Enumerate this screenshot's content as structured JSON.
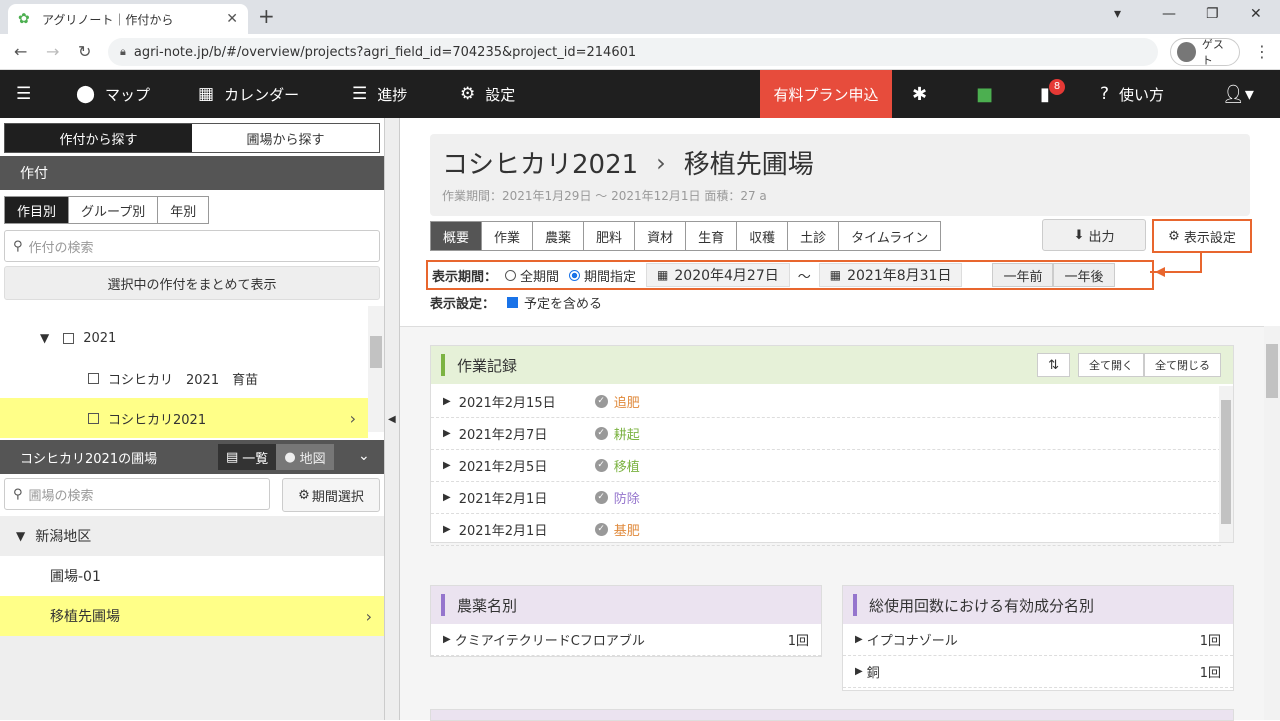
{
  "browser": {
    "tab_title": "アグリノート｜作付から",
    "url": "agri-note.jp/b/#/overview/projects?agri_field_id=704235&project_id=214601",
    "guest_label": "ゲスト"
  },
  "nav": {
    "items": [
      "マップ",
      "カレンダー",
      "進捗",
      "設定"
    ],
    "paid_plan": "有料プラン申込",
    "help": "使い方",
    "notification_count": "8"
  },
  "left": {
    "search_tabs": [
      "作付から探す",
      "圃場から探す"
    ],
    "crop_section": "作付",
    "crop_groups": [
      "作目別",
      "グループ別",
      "年別"
    ],
    "crop_search_placeholder": "作付の検索",
    "show_selected": "選択中の作付をまとめて表示",
    "tree": [
      {
        "label": "2021"
      },
      {
        "label": "コシヒカリ　2021　育苗"
      },
      {
        "label": "コシヒカリ2021"
      }
    ],
    "field_section": "コシヒカリ2021の圃場",
    "view_list": "一覧",
    "view_map": "地図",
    "field_search_placeholder": "圃場の検索",
    "period_select": "期間選択",
    "regions": [
      {
        "label": "新潟地区"
      },
      {
        "label": "圃場-01"
      },
      {
        "label": "移植先圃場"
      }
    ]
  },
  "main": {
    "crumb1": "コシヒカリ2021",
    "crumb2": "移植先圃場",
    "meta": "作業期間：2021年1月29日 ～ 2021年12月1日 面積：27 a",
    "subtabs": [
      "概要",
      "作業",
      "農薬",
      "肥料",
      "資材",
      "生育",
      "収穫",
      "土診",
      "タイムライン"
    ],
    "export": "出力",
    "display_settings": "表示設定",
    "period_label": "表示期間：",
    "all_period": "全期間",
    "specify_period": "期間指定",
    "date_from": "2020年4月27日",
    "tilde": "～",
    "date_to": "2021年8月31日",
    "prev_year": "一年前",
    "next_year": "一年後",
    "disp_label": "表示設定：",
    "include_plan": "予定を含める",
    "work_records": {
      "title": "作業記録",
      "expand_all": "全て開く",
      "collapse_all": "全て閉じる",
      "rows": [
        {
          "date": "2021年2月15日",
          "task": "追肥",
          "color": "#e08a3c"
        },
        {
          "date": "2021年2月7日",
          "task": "耕起",
          "color": "#7cb342"
        },
        {
          "date": "2021年2月5日",
          "task": "移植",
          "color": "#7cb342"
        },
        {
          "date": "2021年2月1日",
          "task": "防除",
          "color": "#9575cd"
        },
        {
          "date": "2021年2月1日",
          "task": "基肥",
          "color": "#e08a3c"
        }
      ]
    },
    "pesticide": {
      "title": "農薬名別",
      "rows": [
        {
          "name": "クミアイテクリードCフロアブル",
          "count": "1回"
        }
      ]
    },
    "active_ingredient": {
      "title": "総使用回数における有効成分名別",
      "rows": [
        {
          "name": "イプコナゾール",
          "count": "1回"
        },
        {
          "name": "銅",
          "count": "1回"
        }
      ]
    }
  }
}
